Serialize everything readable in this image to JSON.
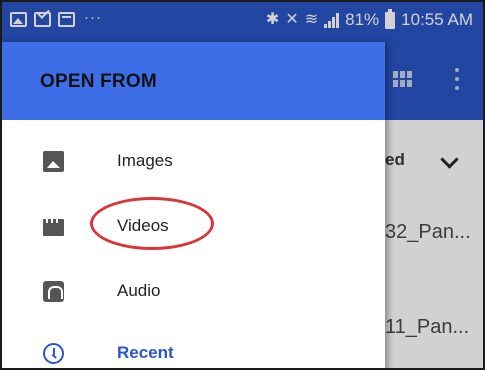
{
  "status_bar": {
    "overflow_dots": "···",
    "bluetooth_glyph": "✱",
    "mute_glyph": "✕",
    "wifi_glyph": "≋",
    "battery_percent": "81%",
    "time": "10:55 AM"
  },
  "drawer": {
    "title": "OPEN FROM",
    "items": [
      {
        "label": "Images",
        "icon": "image-icon"
      },
      {
        "label": "Videos",
        "icon": "video-icon"
      },
      {
        "label": "Audio",
        "icon": "headphones-icon"
      },
      {
        "label": "Recent",
        "icon": "clock-icon",
        "active": true
      }
    ]
  },
  "background_content": {
    "sort_label_partial": "ed",
    "file_names_partial": [
      "32_Pan...",
      "11_Pan..."
    ]
  },
  "colors": {
    "app_bar": "#2a56c6",
    "drawer_header": "#3d6ee8",
    "accent": "#2a56c6",
    "annotation": "#d9363a"
  }
}
